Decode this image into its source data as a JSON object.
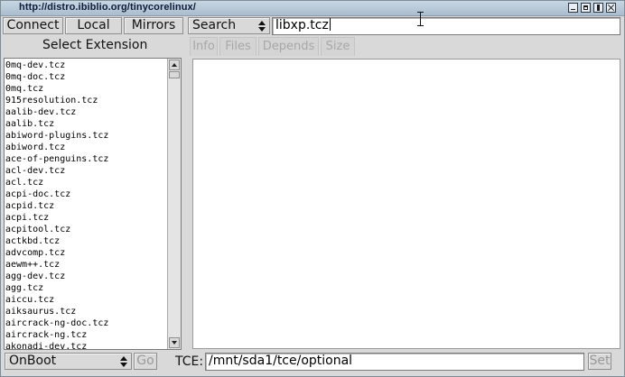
{
  "window": {
    "title": "http://distro.ibiblio.org/tinycorelinux/"
  },
  "toolbar": {
    "connect_label": "Connect",
    "local_label": "Local",
    "mirrors_label": "Mirrors",
    "search_mode": "Search",
    "search_value": "libxp.tcz"
  },
  "sidebar": {
    "heading": "Select Extension",
    "items": [
      "0mq-dev.tcz",
      "0mq-doc.tcz",
      "0mq.tcz",
      "915resolution.tcz",
      "aalib-dev.tcz",
      "aalib.tcz",
      "abiword-plugins.tcz",
      "abiword.tcz",
      "ace-of-penguins.tcz",
      "acl-dev.tcz",
      "acl.tcz",
      "acpi-doc.tcz",
      "acpid.tcz",
      "acpi.tcz",
      "acpitool.tcz",
      "actkbd.tcz",
      "advcomp.tcz",
      "aewm++.tcz",
      "agg-dev.tcz",
      "agg.tcz",
      "aiccu.tcz",
      "aiksaurus.tcz",
      "aircrack-ng-doc.tcz",
      "aircrack-ng.tcz",
      "akonadi-dev.tcz"
    ]
  },
  "tabs": [
    {
      "label": "Info"
    },
    {
      "label": "Files"
    },
    {
      "label": "Depends"
    },
    {
      "label": "Size"
    }
  ],
  "footer": {
    "install_mode": "OnBoot",
    "go_label": "Go",
    "tce_label": "TCE:",
    "tce_path": "/mnt/sda1/tce/optional",
    "set_label": "Set"
  }
}
